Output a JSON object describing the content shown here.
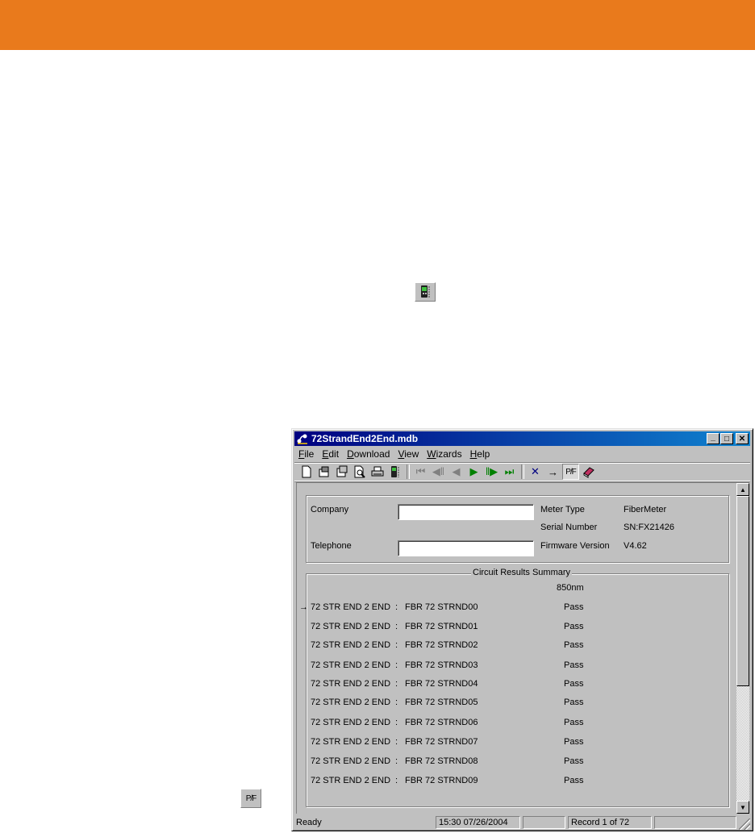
{
  "window": {
    "title": "72StrandEnd2End.mdb",
    "minimize_label": "_",
    "maximize_label": "□",
    "close_label": "✕"
  },
  "menu": [
    {
      "label": "File",
      "accel": "F",
      "rest": "ile"
    },
    {
      "label": "Edit",
      "accel": "E",
      "rest": "dit"
    },
    {
      "label": "Download",
      "accel": "D",
      "rest": "ownload"
    },
    {
      "label": "View",
      "accel": "V",
      "rest": "iew"
    },
    {
      "label": "Wizards",
      "accel": "W",
      "rest": "izards"
    },
    {
      "label": "Help",
      "accel": "H",
      "rest": "elp"
    }
  ],
  "toolbar": {
    "icons": [
      "new-icon",
      "open-icon",
      "save-icon",
      "print-preview-icon",
      "print-icon",
      "meter-icon",
      "first-record-icon",
      "previous-page-icon",
      "previous-record-icon",
      "next-record-icon",
      "next-page-icon",
      "last-record-icon",
      "delete-icon",
      "goto-icon",
      "pass-fail-icon",
      "help-book-icon"
    ],
    "pf_label": "P/F"
  },
  "info": {
    "company_label": "Company",
    "company_value": "",
    "telephone_label": "Telephone",
    "telephone_value": "",
    "meter_type_label": "Meter Type",
    "meter_type_value": "FiberMeter",
    "serial_label": "Serial Number",
    "serial_value": "SN:FX21426",
    "firmware_label": "Firmware Version",
    "firmware_value": "V4.62"
  },
  "summary": {
    "legend": "Circuit Results Summary",
    "column_header": "850nm",
    "current_marker": "→",
    "separator": ":",
    "rows": [
      {
        "circuit": "72 STR END 2 END",
        "fiber": "FBR 72 STRND00",
        "result": "Pass"
      },
      {
        "circuit": "72 STR END 2 END",
        "fiber": "FBR 72 STRND01",
        "result": "Pass"
      },
      {
        "circuit": "72 STR END 2 END",
        "fiber": "FBR 72 STRND02",
        "result": "Pass"
      },
      {
        "circuit": "72 STR END 2 END",
        "fiber": "FBR 72 STRND03",
        "result": "Pass"
      },
      {
        "circuit": "72 STR END 2 END",
        "fiber": "FBR 72 STRND04",
        "result": "Pass"
      },
      {
        "circuit": "72 STR END 2 END",
        "fiber": "FBR 72 STRND05",
        "result": "Pass"
      },
      {
        "circuit": "72 STR END 2 END",
        "fiber": "FBR 72 STRND06",
        "result": "Pass"
      },
      {
        "circuit": "72 STR END 2 END",
        "fiber": "FBR 72 STRND07",
        "result": "Pass"
      },
      {
        "circuit": "72 STR END 2 END",
        "fiber": "FBR 72 STRND08",
        "result": "Pass"
      },
      {
        "circuit": "72 STR END 2 END",
        "fiber": "FBR 72 STRND09",
        "result": "Pass"
      }
    ]
  },
  "status": {
    "ready": "Ready",
    "datetime": "15:30 07/26/2004",
    "empty1": "",
    "record": "Record 1 of 72",
    "empty2": ""
  },
  "colors": {
    "banner": "#e97a1c",
    "title_start": "#000080",
    "title_end": "#1084d0",
    "face": "#c0c0c0"
  },
  "floating_icons": {
    "meter_icon": "meter-icon",
    "pf_label": "P/F"
  }
}
